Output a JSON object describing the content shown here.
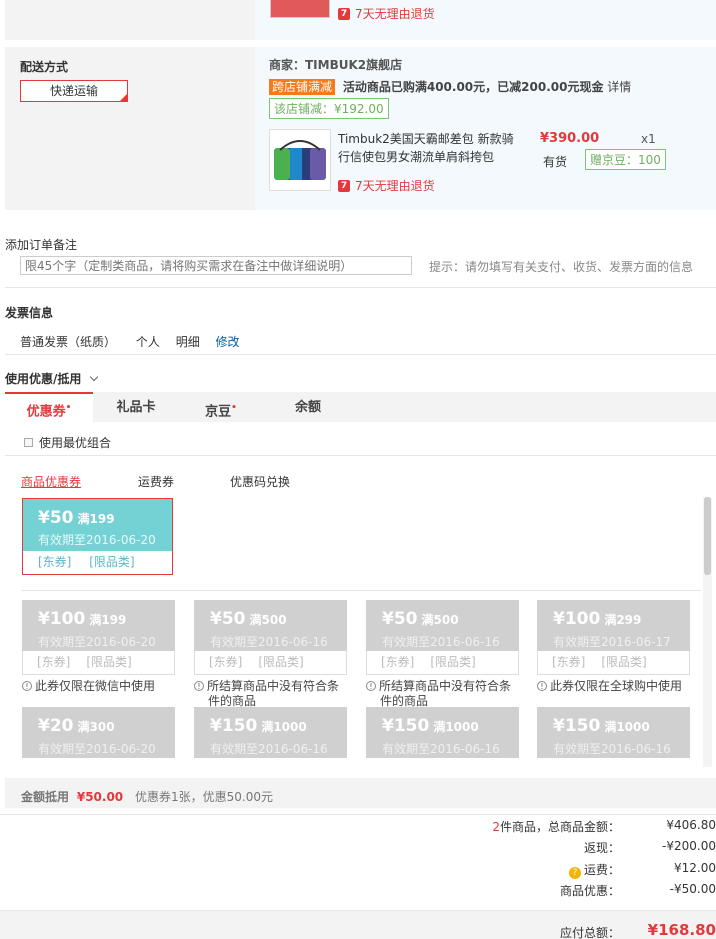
{
  "top_item": {
    "return_policy": "7天无理由退货"
  },
  "delivery": {
    "label": "配送方式",
    "option": "快递运输"
  },
  "shop": {
    "merchant_label": "商家：TIMBUK2旗舰店",
    "promo_tag": "跨店铺满减",
    "promo_text": "活动商品已购满400.00元，已减200.00元现金",
    "promo_link": "详情",
    "shop_discount": "该店铺减：¥192.00",
    "product": {
      "title_line1": "Timbuk2美国天霸邮差包 新款骑",
      "title_line2": "行信使包男女潮流单肩斜挎包",
      "price": "¥390.00",
      "qty": "x1",
      "stock": "有货",
      "beans": "赠京豆：100",
      "return_policy": "7天无理由退货"
    }
  },
  "remark": {
    "label": "添加订单备注",
    "placeholder": "限45个字（定制类商品，请将购买需求在备注中做详细说明）",
    "hint": "提示：请勿填写有关支付、收货、发票方面的信息"
  },
  "invoice": {
    "title": "发票信息",
    "type": "普通发票（纸质）",
    "holder": "个人",
    "content": "明细",
    "edit": "修改"
  },
  "discount": {
    "title": "使用优惠/抵用",
    "tabs": [
      "优惠券",
      "礼品卡",
      "京豆",
      "余额"
    ],
    "best_combo": "使用最优组合",
    "subtabs": [
      "商品优惠券",
      "运费券",
      "优惠码兑换"
    ],
    "active_coupon": {
      "amount": "¥50",
      "cond": "满199",
      "expiry": "有效期至2016-06-20",
      "tag1": "[东券]",
      "tag2": "[限品类]"
    },
    "coupons": [
      {
        "amount": "¥100",
        "cond": "满199",
        "expiry": "有效期至2016-06-20",
        "tag1": "[东券]",
        "tag2": "[限品类]",
        "note1": "此券仅限在微信中使用",
        "note2": ""
      },
      {
        "amount": "¥50",
        "cond": "满500",
        "expiry": "有效期至2016-06-16",
        "tag1": "[东券]",
        "tag2": "[限品类]",
        "note1": "所结算商品中没有符合条",
        "note2": "件的商品"
      },
      {
        "amount": "¥50",
        "cond": "满500",
        "expiry": "有效期至2016-06-16",
        "tag1": "[东券]",
        "tag2": "[限品类]",
        "note1": "所结算商品中没有符合条",
        "note2": "件的商品"
      },
      {
        "amount": "¥100",
        "cond": "满299",
        "expiry": "有效期至2016-06-17",
        "tag1": "[东券]",
        "tag2": "[限品类]",
        "note1": "此券仅限在全球购中使用",
        "note2": ""
      },
      {
        "amount": "¥20",
        "cond": "满300",
        "expiry": "有效期至2016-06-20"
      },
      {
        "amount": "¥150",
        "cond": "满1000",
        "expiry": "有效期至2016-06-16"
      },
      {
        "amount": "¥150",
        "cond": "满1000",
        "expiry": "有效期至2016-06-16"
      },
      {
        "amount": "¥150",
        "cond": "满1000",
        "expiry": "有效期至2016-06-16"
      }
    ],
    "total_label": "金额抵用",
    "total_value": "¥50.00",
    "total_detail": "优惠券1张，优惠50.00元"
  },
  "summary": {
    "count": "2",
    "count_label": "件商品，总商品金额：",
    "goods_total": "¥406.80",
    "rebate_label": "返现：",
    "rebate": "-¥200.00",
    "freight_label": "运费：",
    "freight": "¥12.00",
    "discount_label": "商品优惠：",
    "discount": "-¥50.00",
    "payable_label": "应付总额：",
    "payable": "¥168.80"
  },
  "colors": {
    "accent": "#e4393c",
    "orange": "#f37b1d",
    "green": "#7ac76f",
    "teal": "#74d1d4"
  }
}
